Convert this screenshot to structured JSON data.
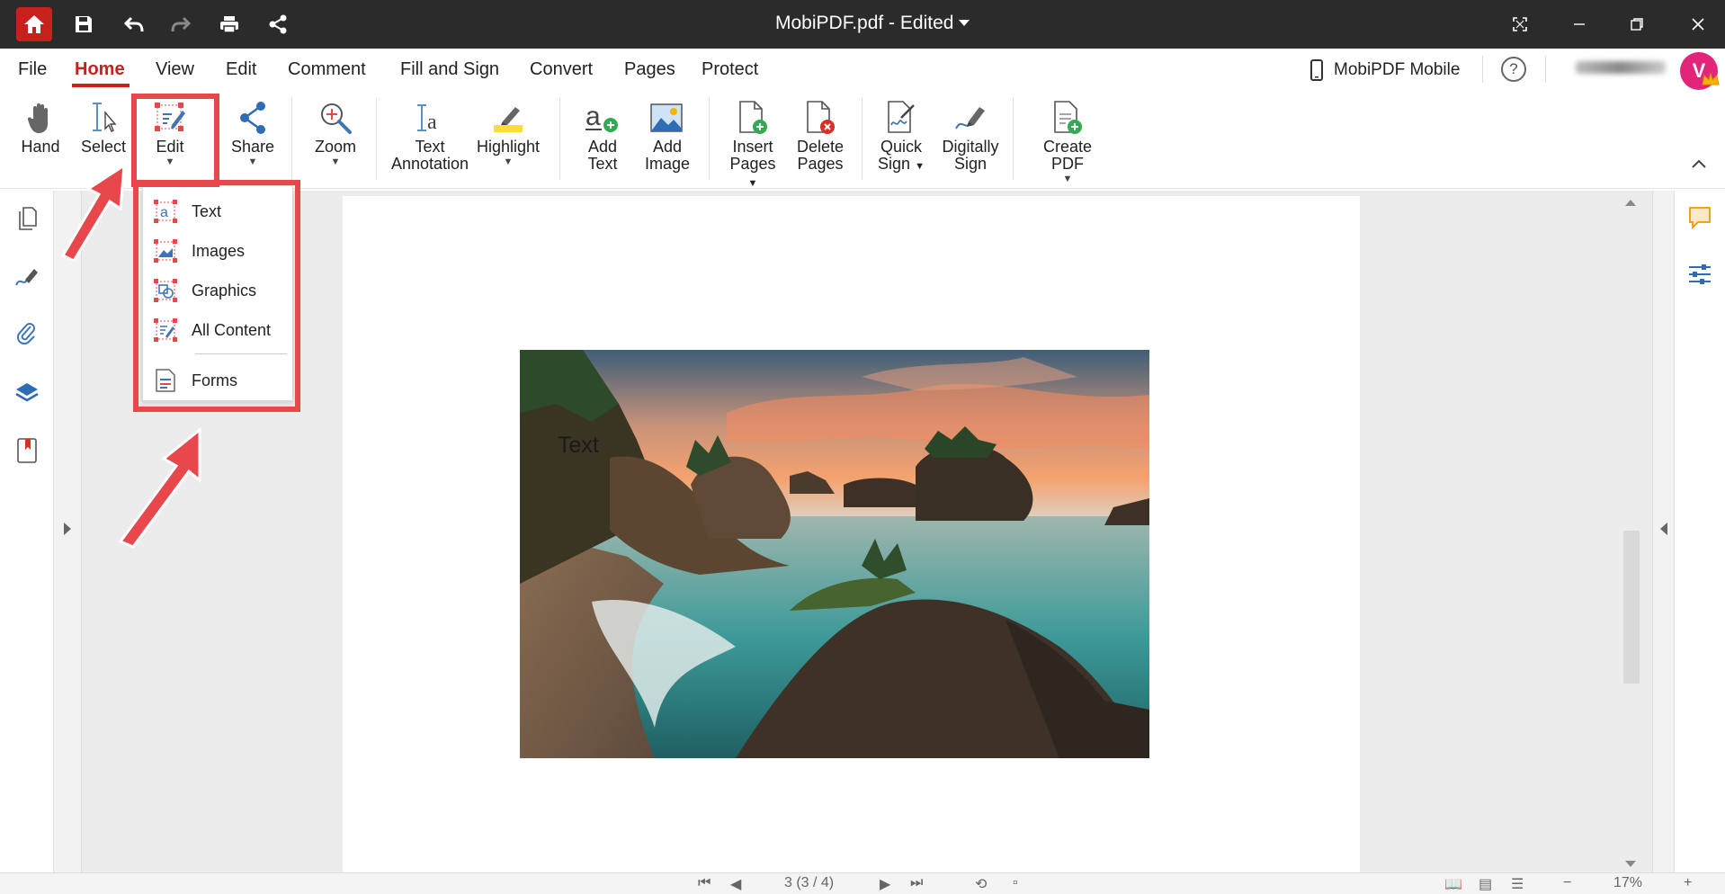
{
  "titlebar": {
    "document_title": "MobiPDF.pdf - Edited"
  },
  "menubar": {
    "items": [
      "File",
      "Home",
      "View",
      "Edit",
      "Comment",
      "Fill and Sign",
      "Convert",
      "Pages",
      "Protect"
    ],
    "active": "Home",
    "mobile_label": "MobiPDF Mobile",
    "help_symbol": "?",
    "avatar_letter": "V"
  },
  "ribbon": {
    "hand": "Hand",
    "select": "Select",
    "edit": "Edit",
    "share": "Share",
    "zoom": "Zoom",
    "text_annotation_1": "Text",
    "text_annotation_2": "Annotation",
    "highlight": "Highlight",
    "add_text_1": "Add",
    "add_text_2": "Text",
    "add_image_1": "Add",
    "add_image_2": "Image",
    "insert_pages_1": "Insert",
    "insert_pages_2": "Pages",
    "delete_pages_1": "Delete",
    "delete_pages_2": "Pages",
    "quick_sign_1": "Quick",
    "quick_sign_2": "Sign",
    "digitally_sign_1": "Digitally",
    "digitally_sign_2": "Sign",
    "create_pdf": "Create PDF"
  },
  "edit_dropdown": {
    "items": [
      "Text",
      "Images",
      "Graphics",
      "All Content",
      "Forms"
    ]
  },
  "document": {
    "overlay_text": "Text"
  },
  "statusbar": {
    "page_indicator": "3 (3 / 4)",
    "zoom": "17%",
    "minus": "−",
    "plus": "+"
  },
  "colors": {
    "accent": "#c8201d",
    "annotation_red": "#e8474b",
    "titlebar_bg": "#2b2b2b"
  }
}
